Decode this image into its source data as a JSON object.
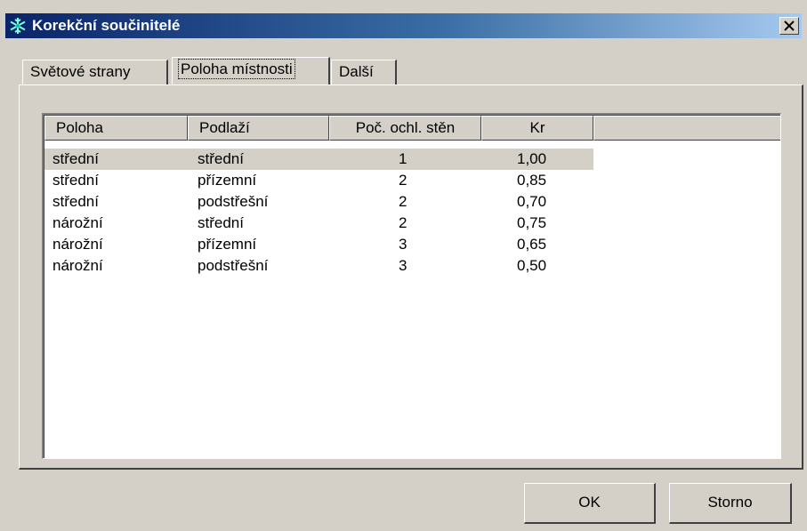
{
  "window": {
    "title": "Korekční součinitelé",
    "icon": "snowflake-icon",
    "close_label": "×"
  },
  "tabs": [
    {
      "label": "Světové strany",
      "active": false
    },
    {
      "label": "Poloha místnosti",
      "active": true
    },
    {
      "label": "Další",
      "active": false
    }
  ],
  "table": {
    "columns": [
      "Poloha",
      "Podlaží",
      "Poč. ochl. stěn",
      "Kr"
    ],
    "rows": [
      {
        "poloha": "střední",
        "podlazi": "střední",
        "steny": "1",
        "kr": "1,00",
        "selected": true
      },
      {
        "poloha": "střední",
        "podlazi": "přízemní",
        "steny": "2",
        "kr": "0,85",
        "selected": false
      },
      {
        "poloha": "střední",
        "podlazi": "podstřešní",
        "steny": "2",
        "kr": "0,70",
        "selected": false
      },
      {
        "poloha": "nárožní",
        "podlazi": "střední",
        "steny": "2",
        "kr": "0,75",
        "selected": false
      },
      {
        "poloha": "nárožní",
        "podlazi": "přízemní",
        "steny": "3",
        "kr": "0,65",
        "selected": false
      },
      {
        "poloha": "nárožní",
        "podlazi": "podstřešní",
        "steny": "3",
        "kr": "0,50",
        "selected": false
      }
    ]
  },
  "buttons": {
    "ok_label": "OK",
    "cancel_label": "Storno"
  },
  "colors": {
    "title_bar_start": "#0a246a",
    "title_bar_end": "#a6caf0",
    "face": "#d4d0c8"
  }
}
